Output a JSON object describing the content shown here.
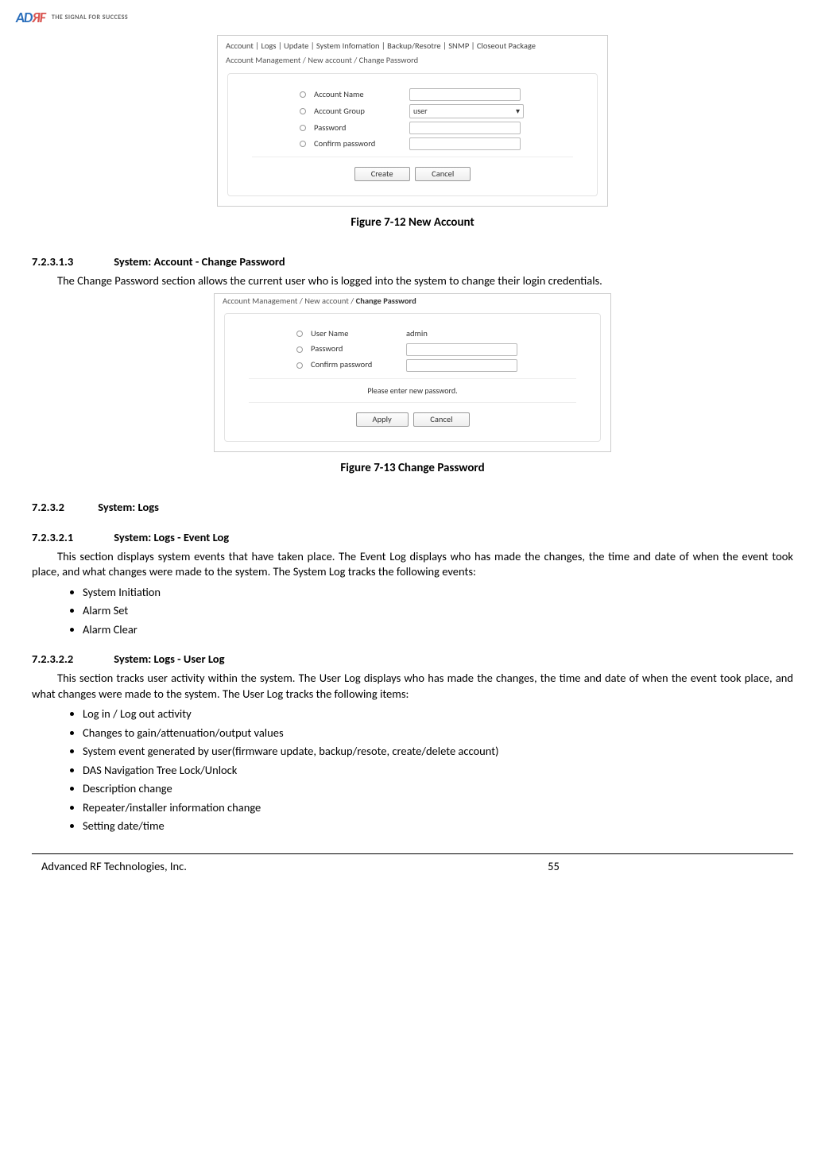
{
  "header": {
    "logo_a": "A",
    "logo_d": "D",
    "logo_rf": "ЯF",
    "tagline": "THE SIGNAL FOR SUCCESS"
  },
  "screenshot1": {
    "tabs": "Account   |   Logs   |   Update   |   System Infomation   |   Backup/Resotre   |   SNMP   |   Closeout Package",
    "breadcrumb_prefix": "Account Management / New account / ",
    "breadcrumb_active": "Change Password",
    "rows": {
      "account_name": "Account Name",
      "account_group": "Account Group",
      "account_group_value": "user",
      "password": "Password",
      "confirm_password": "Confirm password"
    },
    "buttons": {
      "create": "Create",
      "cancel": "Cancel"
    }
  },
  "caption1": "Figure 7-12   New Account",
  "sec_72313": {
    "num": "7.2.3.1.3",
    "title": "System: Account - Change Password",
    "body": "The Change Password section allows the current user who is logged into the system to change their login credentials."
  },
  "screenshot2": {
    "breadcrumb_prefix": "Account Management / New account / ",
    "breadcrumb_active": "Change Password",
    "rows": {
      "user_name": "User Name",
      "user_name_value": "admin",
      "password": "Password",
      "confirm_password": "Confirm password"
    },
    "note": "Please enter new password.",
    "buttons": {
      "apply": "Apply",
      "cancel": "Cancel"
    }
  },
  "caption2": "Figure 7-13   Change Password",
  "sec_7232": {
    "num": "7.2.3.2",
    "title": "System: Logs"
  },
  "sec_72321": {
    "num": "7.2.3.2.1",
    "title": "System: Logs - Event Log",
    "body": "This section displays system events that have taken place. The Event Log displays who has made the changes, the time and date of when the event took place, and what changes were made to the system. The System Log tracks the following events:",
    "bullets": [
      "System Initiation",
      "Alarm Set",
      "Alarm Clear"
    ]
  },
  "sec_72322": {
    "num": "7.2.3.2.2",
    "title": "System: Logs - User Log",
    "body": "This section tracks user activity within the system.  The User Log displays who has made the changes, the time and date of when the event took place, and what changes were made to the system. The User Log tracks the following items:",
    "bullets": [
      "Log in / Log out activity",
      "Changes to gain/attenuation/output values",
      "System event generated by user(firmware update, backup/resote, create/delete account)",
      "DAS Navigation Tree Lock/Unlock",
      "Description change",
      "Repeater/installer information change",
      "Setting date/time"
    ]
  },
  "footer": {
    "company": "Advanced RF Technologies, Inc.",
    "page": "55"
  }
}
